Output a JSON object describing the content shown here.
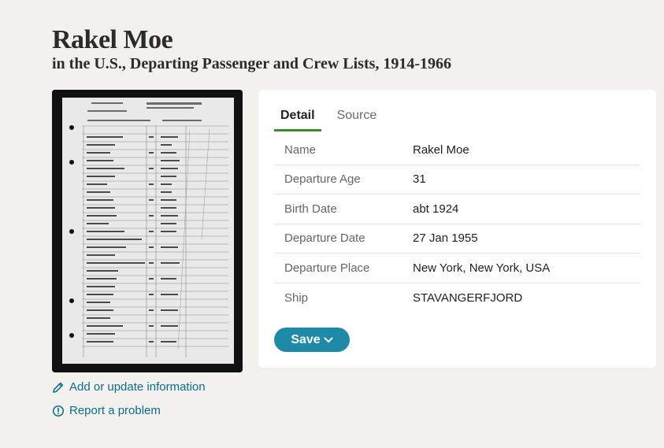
{
  "header": {
    "title": "Rakel Moe",
    "subtitle": "in the U.S., Departing Passenger and Crew Lists, 1914-1966"
  },
  "actions": {
    "edit_label": "Add or update information",
    "report_label": "Report a problem"
  },
  "tabs": [
    {
      "label": "Detail",
      "active": true
    },
    {
      "label": "Source",
      "active": false
    }
  ],
  "details": [
    {
      "label": "Name",
      "value": "Rakel Moe"
    },
    {
      "label": "Departure Age",
      "value": "31"
    },
    {
      "label": "Birth Date",
      "value": "abt 1924"
    },
    {
      "label": "Departure Date",
      "value": "27 Jan 1955"
    },
    {
      "label": "Departure Place",
      "value": "New York, New York, USA"
    },
    {
      "label": "Ship",
      "value": "STAVANGERFJORD"
    }
  ],
  "save_label": "Save",
  "colors": {
    "accent": "#1f8aa8",
    "link": "#0a6e8c",
    "tab_underline": "#3d8c2b",
    "background": "#f3f1ee"
  }
}
